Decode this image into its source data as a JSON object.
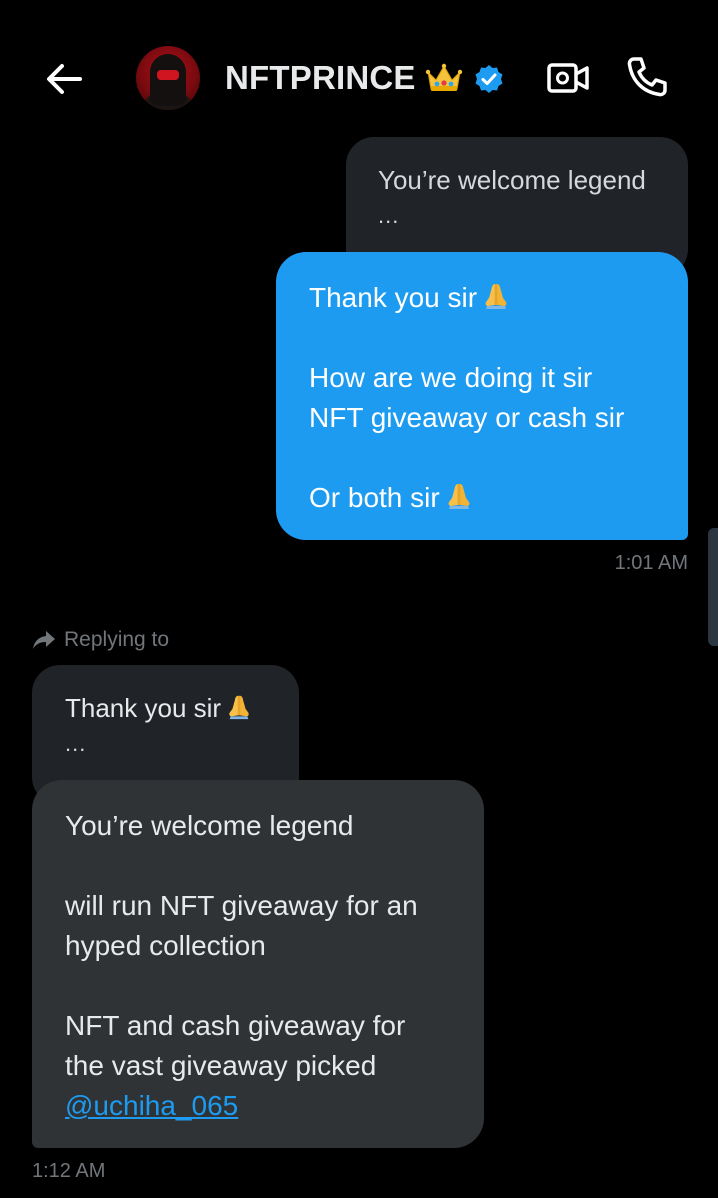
{
  "header": {
    "name": "NFTPRINCE",
    "crown_icon": "crown-emoji",
    "verified_icon": "verified-badge-icon",
    "back_icon": "back-arrow-icon",
    "video_icon": "video-call-icon",
    "call_icon": "phone-icon"
  },
  "colors": {
    "background": "#000000",
    "accent": "#1d9bf0",
    "incoming_bubble": "#2f3336",
    "quote_bubble": "#202327",
    "muted_text": "#71767b"
  },
  "messages": {
    "quote1": {
      "text": "You’re welcome legend",
      "dots": "..."
    },
    "sent": {
      "line1": "Thank you sir",
      "line2": "How are we doing it sir",
      "line3": "NFT giveaway or cash sir",
      "line4": "Or both sir",
      "emoji": "folded-hands-emoji",
      "time": "1:01 AM"
    },
    "replying": {
      "label": "Replying to",
      "icon": "reply-arrow-icon"
    },
    "quote2": {
      "text": "Thank you sir",
      "dots": "..."
    },
    "received": {
      "line1": "You’re welcome legend",
      "line2": "will run NFT giveaway for an",
      "line3": "hyped collection",
      "line4": "NFT and cash giveaway for",
      "line5": "the vast giveaway picked",
      "mention": "@uchiha_065",
      "time": "1:12 AM"
    }
  }
}
